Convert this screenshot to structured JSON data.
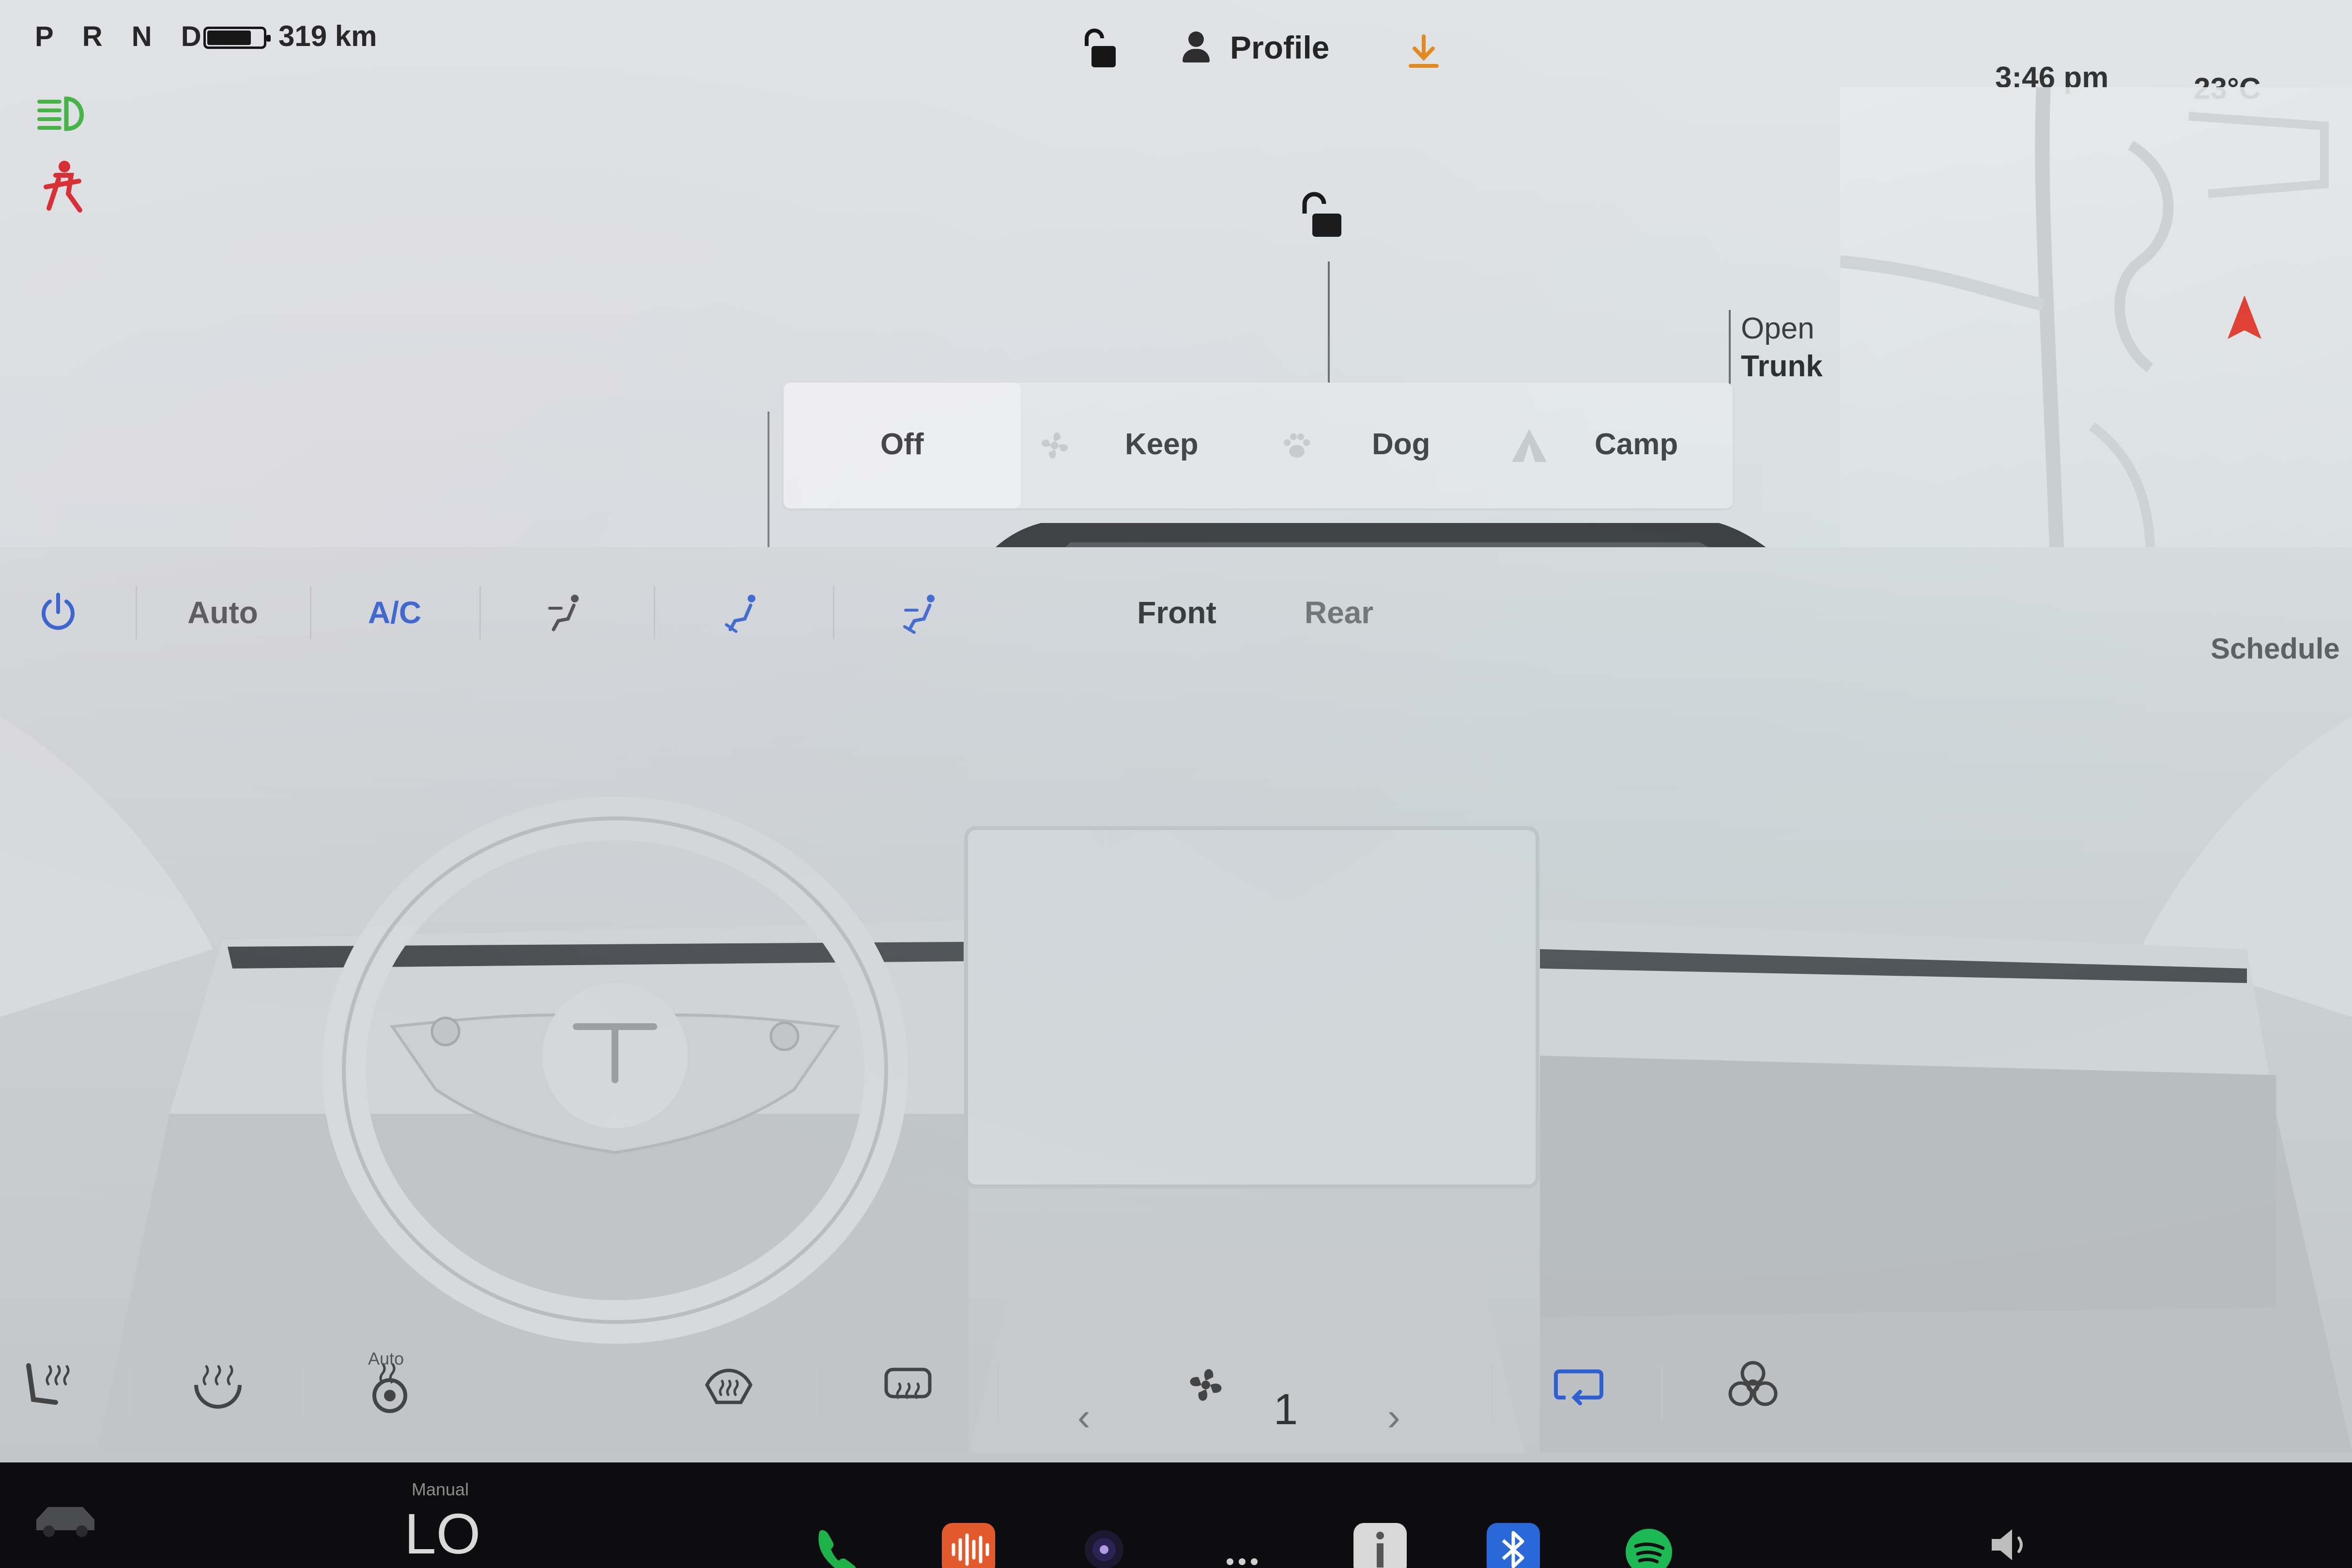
{
  "status_bar": {
    "gear": "P R N D",
    "battery_fraction": 0.75,
    "range": "319 km",
    "profile_label": "Profile",
    "time": "3:46 pm",
    "temperature": "23°C",
    "icons": [
      "lock-open-icon",
      "person-icon",
      "download-icon",
      "headlights-icon",
      "seatbelt-warning-icon"
    ]
  },
  "car_view": {
    "trunk_label_line1": "Open",
    "trunk_label_line2": "Trunk",
    "lock_icon": "lock-open-icon"
  },
  "keep_climate": {
    "options": [
      {
        "label": "Off",
        "icon": "",
        "selected": true
      },
      {
        "label": "Keep",
        "icon": "fan-icon",
        "selected": false
      },
      {
        "label": "Dog",
        "icon": "paw-icon",
        "selected": false
      },
      {
        "label": "Camp",
        "icon": "tent-icon",
        "selected": false
      }
    ]
  },
  "climate": {
    "power_icon": "power-icon",
    "auto_label": "Auto",
    "ac_label": "A/C",
    "airflow_icons": [
      "airflow-face-icon",
      "airflow-face-feet-icon",
      "airflow-feet-icon"
    ],
    "zone_front": "Front",
    "zone_rear": "Rear",
    "schedule_label": "Schedule",
    "fan_speed": "1",
    "seat_heater_auto_label": "Auto",
    "accent_color": "#2f5fd0"
  },
  "bottom_controls": {
    "icons": [
      "seat-heater-icon",
      "steering-wheel-heater-icon",
      "seat-heater-auto-icon",
      "front-defrost-icon",
      "rear-defrost-icon",
      "chevron-left-icon",
      "fan-icon",
      "chevron-right-icon",
      "recirculate-icon",
      "bioweapon-mode-icon"
    ]
  },
  "dock": {
    "mode_label": "Manual",
    "temp_label": "LO",
    "apps": [
      "phone-icon",
      "audio-icon",
      "camera-icon",
      "more-icon",
      "info-icon",
      "bluetooth-icon",
      "spotify-icon"
    ],
    "volume_icon": "volume-icon",
    "colors": {
      "phone": "#1fb24a",
      "audio": "#e2592b",
      "bluetooth": "#2a68d8",
      "spotify": "#1db954"
    }
  }
}
